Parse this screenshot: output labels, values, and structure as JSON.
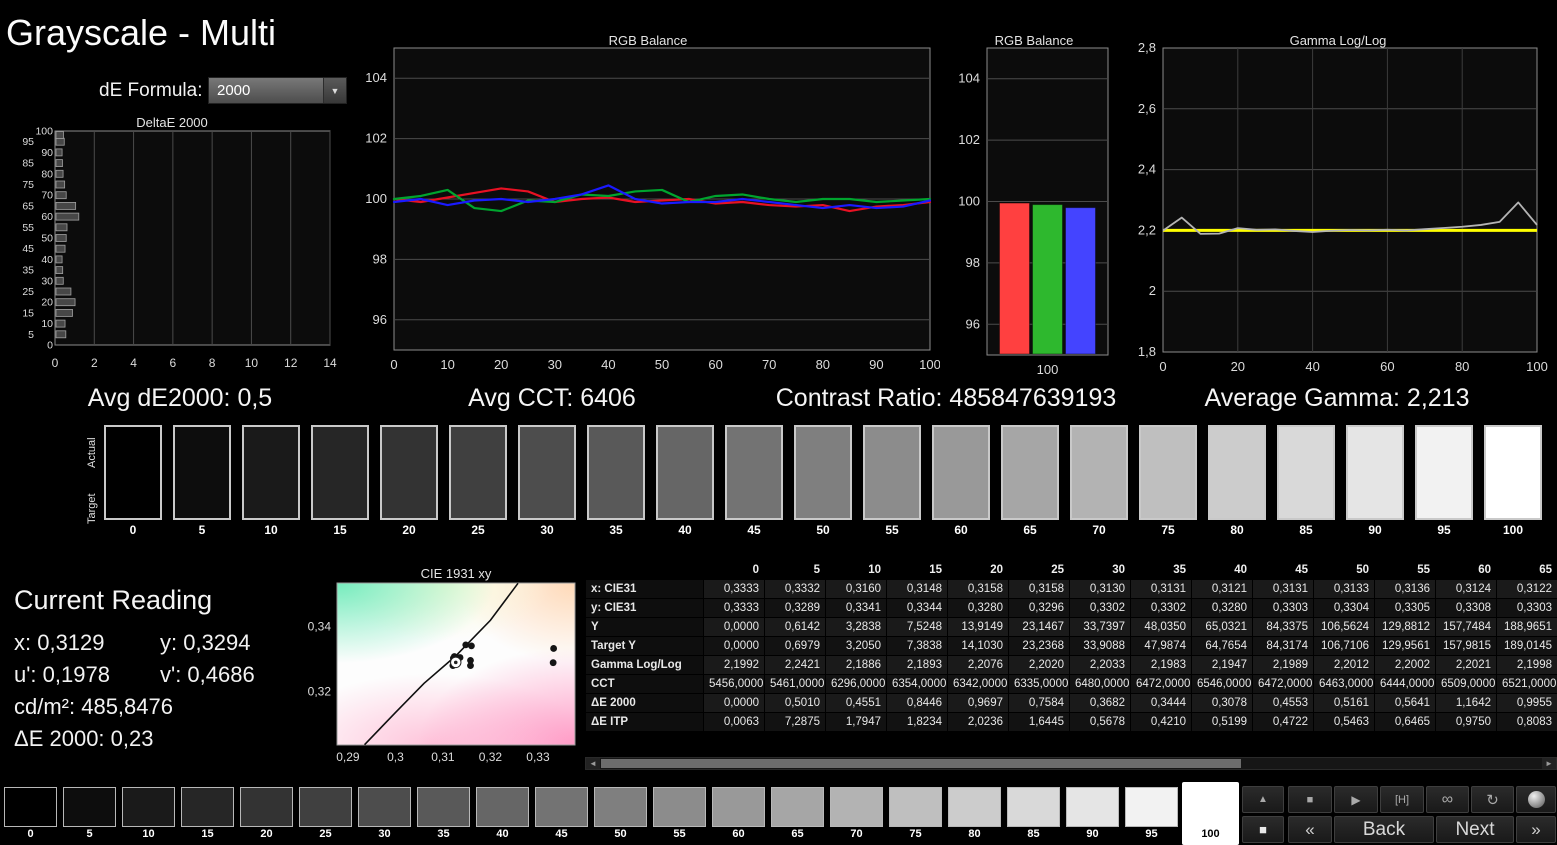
{
  "window": {
    "title": "Grayscale - Multi"
  },
  "controls": {
    "de_formula_label": "dE Formula:",
    "de_formula_value": "2000"
  },
  "stats": [
    {
      "text": "Avg dE2000: 0,5"
    },
    {
      "text": "Avg CCT: 6406"
    },
    {
      "text": "Contrast Ratio: 485847639193"
    },
    {
      "text": "Average Gamma: 2,213"
    }
  ],
  "swatch_strip": {
    "actual_label": "Actual",
    "target_label": "Target",
    "levels": [
      0,
      5,
      10,
      15,
      20,
      25,
      30,
      35,
      40,
      45,
      50,
      55,
      60,
      65,
      70,
      75,
      80,
      85,
      90,
      95,
      100
    ]
  },
  "bottom_strip": {
    "levels": [
      0,
      5,
      10,
      15,
      20,
      25,
      30,
      35,
      40,
      45,
      50,
      55,
      60,
      65,
      70,
      75,
      80,
      85,
      90,
      95,
      100
    ],
    "selected_level": 100
  },
  "current_reading": {
    "title": "Current Reading",
    "x": "x: 0,3129",
    "y": "y: 0,3294",
    "u": "u': 0,1978",
    "v": "v': 0,4686",
    "luminance": "cd/m²: 485,8476",
    "de2000": "ΔE 2000: 0,23"
  },
  "table": {
    "columns": [
      "0",
      "5",
      "10",
      "15",
      "20",
      "25",
      "30",
      "35",
      "40",
      "45",
      "50",
      "55",
      "60",
      "65"
    ],
    "rows": [
      {
        "label": "x: CIE31",
        "values": [
          "0,3333",
          "0,3332",
          "0,3160",
          "0,3148",
          "0,3158",
          "0,3158",
          "0,3130",
          "0,3131",
          "0,3121",
          "0,3131",
          "0,3133",
          "0,3136",
          "0,3124",
          "0,3122"
        ]
      },
      {
        "label": "y: CIE31",
        "values": [
          "0,3333",
          "0,3289",
          "0,3341",
          "0,3344",
          "0,3280",
          "0,3296",
          "0,3302",
          "0,3302",
          "0,3280",
          "0,3303",
          "0,3304",
          "0,3305",
          "0,3308",
          "0,3303"
        ]
      },
      {
        "label": "Y",
        "values": [
          "0,0000",
          "0,6142",
          "3,2838",
          "7,5248",
          "13,9149",
          "23,1467",
          "33,7397",
          "48,0350",
          "65,0321",
          "84,3375",
          "106,5624",
          "129,8812",
          "157,7484",
          "188,9651"
        ]
      },
      {
        "label": "Target Y",
        "values": [
          "0,0000",
          "0,6979",
          "3,2050",
          "7,3838",
          "14,1030",
          "23,2368",
          "33,9088",
          "47,9874",
          "64,7654",
          "84,3174",
          "106,7106",
          "129,9561",
          "157,9815",
          "189,0145"
        ]
      },
      {
        "label": "Gamma Log/Log",
        "values": [
          "2,1992",
          "2,2421",
          "2,1886",
          "2,1893",
          "2,2076",
          "2,2020",
          "2,2033",
          "2,1983",
          "2,1947",
          "2,1989",
          "2,2012",
          "2,2002",
          "2,2021",
          "2,1998"
        ]
      },
      {
        "label": "CCT",
        "values": [
          "5456,0000",
          "5461,0000",
          "6296,0000",
          "6354,0000",
          "6342,0000",
          "6335,0000",
          "6480,0000",
          "6472,0000",
          "6546,0000",
          "6472,0000",
          "6463,0000",
          "6444,0000",
          "6509,0000",
          "6521,0000"
        ]
      },
      {
        "label": "ΔE 2000",
        "values": [
          "0,0000",
          "0,5010",
          "0,4551",
          "0,8446",
          "0,9697",
          "0,7584",
          "0,3682",
          "0,3444",
          "0,3078",
          "0,4553",
          "0,5161",
          "0,5641",
          "1,1642",
          "0,9955"
        ]
      },
      {
        "label": "ΔE ITP",
        "values": [
          "0,0063",
          "7,2875",
          "1,7947",
          "1,8234",
          "2,0236",
          "1,6445",
          "0,5678",
          "0,4210",
          "0,5199",
          "0,4722",
          "0,5463",
          "0,6465",
          "0,9750",
          "0,8083"
        ]
      }
    ]
  },
  "transport": {
    "row1": [
      {
        "name": "scroll-up-button",
        "glyph": "▲"
      },
      {
        "name": "stop-button",
        "glyph": "■"
      },
      {
        "name": "play-button",
        "glyph": "▶"
      },
      {
        "name": "measure-h-button",
        "glyph": "[H]"
      },
      {
        "name": "infinity-button",
        "glyph": "∞"
      },
      {
        "name": "refresh-button",
        "glyph": "↻"
      },
      {
        "name": "sphere-button",
        "glyph": "●"
      }
    ],
    "row2": [
      {
        "name": "black-square-button",
        "glyph": "■"
      },
      {
        "name": "page-first-button",
        "glyph": "«"
      },
      {
        "name": "back-button",
        "glyph": "Back"
      },
      {
        "name": "next-button",
        "glyph": "Next"
      },
      {
        "name": "page-last-button",
        "glyph": "»"
      }
    ]
  },
  "chart_data": [
    {
      "id": "deltae-bars",
      "type": "bar",
      "orientation": "horizontal",
      "title": "DeltaE 2000",
      "categories": [
        0,
        5,
        10,
        15,
        20,
        25,
        30,
        35,
        40,
        45,
        50,
        55,
        60,
        65,
        70,
        75,
        80,
        85,
        90,
        95,
        100
      ],
      "values": [
        0.0,
        0.5,
        0.46,
        0.84,
        0.97,
        0.76,
        0.37,
        0.34,
        0.31,
        0.46,
        0.52,
        0.56,
        1.16,
        1.0,
        0.52,
        0.44,
        0.36,
        0.33,
        0.31,
        0.42,
        0.38
      ],
      "xlim": [
        0,
        14
      ],
      "xticks": [
        0,
        2,
        4,
        6,
        8,
        10,
        12,
        14
      ]
    },
    {
      "id": "rgb-balance-line",
      "type": "line",
      "title": "RGB Balance",
      "x": [
        0,
        5,
        10,
        15,
        20,
        25,
        30,
        35,
        40,
        45,
        50,
        55,
        60,
        65,
        70,
        75,
        80,
        85,
        90,
        95,
        100
      ],
      "ylim": [
        95,
        105
      ],
      "yticks": [
        96,
        98,
        100,
        102,
        104
      ],
      "xticks": [
        0,
        10,
        20,
        30,
        40,
        50,
        60,
        70,
        80,
        90,
        100
      ],
      "series": [
        {
          "name": "red",
          "color": "#e81123",
          "values": [
            100.0,
            99.9,
            100.05,
            100.2,
            100.35,
            100.25,
            99.9,
            100.0,
            100.05,
            99.9,
            99.95,
            100.0,
            99.85,
            99.9,
            99.8,
            99.75,
            99.8,
            99.6,
            99.75,
            99.8,
            99.9
          ]
        },
        {
          "name": "green",
          "color": "#00a42e",
          "values": [
            100.0,
            100.1,
            100.3,
            99.7,
            99.6,
            99.95,
            99.9,
            100.15,
            100.1,
            100.25,
            100.3,
            99.9,
            100.1,
            100.15,
            100.0,
            99.9,
            100.0,
            100.0,
            99.9,
            99.95,
            100.0
          ]
        },
        {
          "name": "blue",
          "color": "#1a1aff",
          "values": [
            99.9,
            100.0,
            99.8,
            99.95,
            100.0,
            99.9,
            100.0,
            100.15,
            100.45,
            100.0,
            99.85,
            99.9,
            99.9,
            100.0,
            99.9,
            99.8,
            99.7,
            99.8,
            99.7,
            99.75,
            99.95
          ]
        }
      ]
    },
    {
      "id": "rgb-balance-bars",
      "type": "bar",
      "title": "RGB Balance",
      "categories": [
        "red",
        "green",
        "blue"
      ],
      "colors": [
        "#ff4040",
        "#2eb82e",
        "#4444ff"
      ],
      "values": [
        99.95,
        99.9,
        99.8
      ],
      "ylim": [
        95,
        105
      ],
      "yticks": [
        96,
        98,
        100,
        102,
        104
      ],
      "xtick_label": "100"
    },
    {
      "id": "gamma-loglog",
      "type": "line",
      "title": "Gamma Log/Log",
      "x": [
        0,
        5,
        10,
        15,
        20,
        25,
        30,
        35,
        40,
        45,
        50,
        55,
        60,
        65,
        70,
        75,
        80,
        85,
        90,
        95,
        100
      ],
      "ylim": [
        1.8,
        2.8
      ],
      "yticks": [
        1.8,
        2.0,
        2.2,
        2.4,
        2.6,
        2.8
      ],
      "ytick_labels": [
        "1,8",
        "2",
        "2,2",
        "2,4",
        "2,6",
        "2,8"
      ],
      "xticks": [
        0,
        20,
        40,
        60,
        80,
        100
      ],
      "series": [
        {
          "name": "target",
          "color": "#ffff00",
          "values": [
            2.2,
            2.2,
            2.2,
            2.2,
            2.2,
            2.2,
            2.2,
            2.2,
            2.2,
            2.2,
            2.2,
            2.2,
            2.2,
            2.2,
            2.2,
            2.2,
            2.2,
            2.2,
            2.2,
            2.2,
            2.2
          ]
        },
        {
          "name": "measured",
          "color": "#b4b4b4",
          "values": [
            2.1992,
            2.2421,
            2.1886,
            2.1893,
            2.2076,
            2.202,
            2.2033,
            2.1983,
            2.1947,
            2.1989,
            2.2012,
            2.2002,
            2.2021,
            2.1998,
            2.204,
            2.208,
            2.212,
            2.218,
            2.228,
            2.292,
            2.218
          ]
        }
      ]
    },
    {
      "id": "cie-1931",
      "type": "scatter",
      "title": "CIE 1931 xy",
      "xlim": [
        0.2877,
        0.3378
      ],
      "ylim": [
        0.3035,
        0.3535
      ],
      "xticks": [
        0.29,
        0.3,
        0.31,
        0.32,
        0.33
      ],
      "xtick_labels": [
        "0,29",
        "0,3",
        "0,31",
        "0,32",
        "0,33"
      ],
      "yticks": [
        0.34,
        0.32
      ],
      "ytick_labels": [
        "0,34",
        "0,32"
      ],
      "points": [
        [
          0.3333,
          0.3333
        ],
        [
          0.3332,
          0.3289
        ],
        [
          0.316,
          0.3341
        ],
        [
          0.3148,
          0.3344
        ],
        [
          0.3158,
          0.328
        ],
        [
          0.3158,
          0.3296
        ],
        [
          0.313,
          0.3302
        ],
        [
          0.3131,
          0.3302
        ],
        [
          0.3121,
          0.328
        ],
        [
          0.3131,
          0.3303
        ],
        [
          0.3133,
          0.3304
        ],
        [
          0.3136,
          0.3305
        ],
        [
          0.3124,
          0.3308
        ],
        [
          0.3122,
          0.3303
        ]
      ],
      "target_point": [
        0.3127,
        0.329
      ],
      "locus": [
        [
          0.2935,
          0.3036
        ],
        [
          0.3,
          0.3135
        ],
        [
          0.306,
          0.3225
        ],
        [
          0.3127,
          0.331
        ],
        [
          0.32,
          0.342
        ],
        [
          0.3258,
          0.3534
        ]
      ]
    }
  ]
}
